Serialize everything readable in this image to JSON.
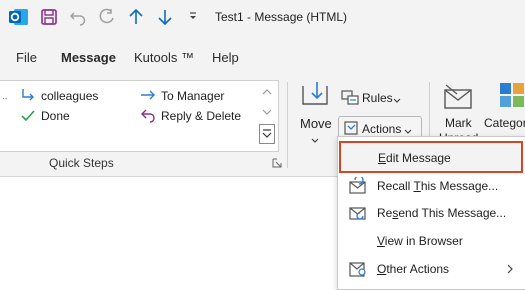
{
  "window": {
    "title": "Test1  -  Message (HTML)"
  },
  "menu": {
    "tabs": [
      "File",
      "Message",
      "Kutools ™",
      "Help"
    ],
    "active": "Message"
  },
  "quick_steps": {
    "items": [
      {
        "label": "colleagues"
      },
      {
        "label": "Done"
      },
      {
        "label": "To Manager"
      },
      {
        "label": "Reply & Delete"
      }
    ],
    "group_label": "Quick Steps"
  },
  "move_group": {
    "move_label": "Move",
    "rules_label": "Rules",
    "actions_label": "Actions",
    "mark_unread_label_1": "Mark",
    "mark_unread_label_2": "Unread",
    "categorize_label": "Categor"
  },
  "actions_menu": {
    "items": [
      {
        "label": "Edit Message",
        "accel": "E",
        "pre": "",
        "post": "dit Message"
      },
      {
        "label": "Recall This Message...",
        "pre": "Recall ",
        "accel": "T",
        "post": "his Message..."
      },
      {
        "label": "Resend This Message...",
        "pre": "Re",
        "accel": "s",
        "post": "end This Message..."
      },
      {
        "label": "View in Browser",
        "pre": "",
        "accel": "V",
        "post": "iew in Browser"
      },
      {
        "label": "Other Actions",
        "pre": "",
        "accel": "O",
        "post": "ther Actions"
      }
    ]
  },
  "colors": {
    "accent": "#0f6cbd",
    "highlight_border": "#d24726",
    "outlook_blue": "#0364b8",
    "save_purple": "#8b2d8e"
  }
}
